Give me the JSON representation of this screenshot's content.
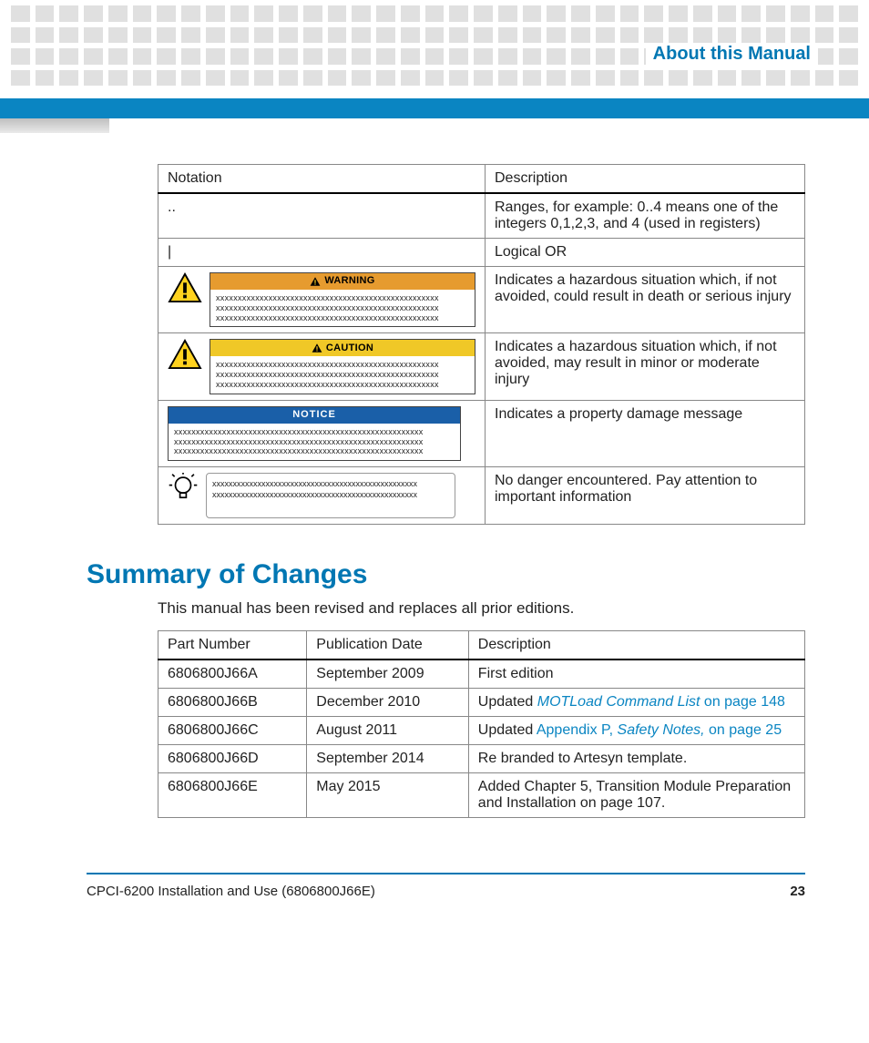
{
  "header": {
    "section_title": "About this Manual"
  },
  "notation_table": {
    "headers": [
      "Notation",
      "Description"
    ],
    "rows": [
      {
        "notation": "..",
        "description": "Ranges, for example: 0..4 means one of the integers 0,1,2,3, and 4 (used in registers)"
      },
      {
        "notation": "|",
        "description": "Logical OR"
      },
      {
        "notation_type": "warning",
        "bar_label": "WARNING",
        "placeholder": "xxxxxxxxxxxxxxxxxxxxxxxxxxxxxxxxxxxxxxxxxxxxxxxxxxx\nxxxxxxxxxxxxxxxxxxxxxxxxxxxxxxxxxxxxxxxxxxxxxxxxxxx\nxxxxxxxxxxxxxxxxxxxxxxxxxxxxxxxxxxxxxxxxxxxxxxxxxxx",
        "description": "Indicates a hazardous situation which, if not avoided, could result in death or serious injury"
      },
      {
        "notation_type": "caution",
        "bar_label": "CAUTION",
        "placeholder": "xxxxxxxxxxxxxxxxxxxxxxxxxxxxxxxxxxxxxxxxxxxxxxxxxxx\nxxxxxxxxxxxxxxxxxxxxxxxxxxxxxxxxxxxxxxxxxxxxxxxxxxx\nxxxxxxxxxxxxxxxxxxxxxxxxxxxxxxxxxxxxxxxxxxxxxxxxxxx",
        "description": "Indicates a hazardous situation which, if not avoided, may result in minor or moderate injury"
      },
      {
        "notation_type": "notice",
        "bar_label": "NOTICE",
        "placeholder": "xxxxxxxxxxxxxxxxxxxxxxxxxxxxxxxxxxxxxxxxxxxxxxxxxxxxxxxxx\nxxxxxxxxxxxxxxxxxxxxxxxxxxxxxxxxxxxxxxxxxxxxxxxxxxxxxxxxx\nxxxxxxxxxxxxxxxxxxxxxxxxxxxxxxxxxxxxxxxxxxxxxxxxxxxxxxxxx",
        "description": "Indicates a property damage message"
      },
      {
        "notation_type": "info",
        "placeholder": "xxxxxxxxxxxxxxxxxxxxxxxxxxxxxxxxxxxxxxxxxxxxxxxxxx\nxxxxxxxxxxxxxxxxxxxxxxxxxxxxxxxxxxxxxxxxxxxxxxxxxx",
        "description": "No danger encountered. Pay attention to important information"
      }
    ]
  },
  "section_heading": "Summary of Changes",
  "intro_text": "This manual has been revised and replaces all prior editions.",
  "changes_table": {
    "headers": [
      "Part Number",
      "Publication Date",
      "Description"
    ],
    "rows": [
      {
        "part": "6806800J66A",
        "date": "September 2009",
        "desc_prefix": "First edition",
        "link_text": "",
        "link_text2": "",
        "suffix": ""
      },
      {
        "part": "6806800J66B",
        "date": "December 2010",
        "desc_prefix": "Updated ",
        "link_text": "MOTLoad Command List",
        "link_text2": " on page 148",
        "suffix": ""
      },
      {
        "part": "6806800J66C",
        "date": "August 2011",
        "desc_prefix": "Updated ",
        "link_text": "Appendix P, ",
        "link_italic": "Safety Notes,",
        "link_text2": " on page 25",
        "suffix": ""
      },
      {
        "part": "6806800J66D",
        "date": "September 2014",
        "desc_prefix": "Re branded to Artesyn template.",
        "link_text": "",
        "link_text2": "",
        "suffix": ""
      },
      {
        "part": "6806800J66E",
        "date": "May 2015",
        "desc_prefix": "Added Chapter 5, Transition Module Preparation and Installation on page 107.",
        "link_text": "",
        "link_text2": "",
        "suffix": ""
      }
    ]
  },
  "footer": {
    "doc_title": "CPCI-6200 Installation and Use (6806800J66E)",
    "page_number": "23"
  }
}
